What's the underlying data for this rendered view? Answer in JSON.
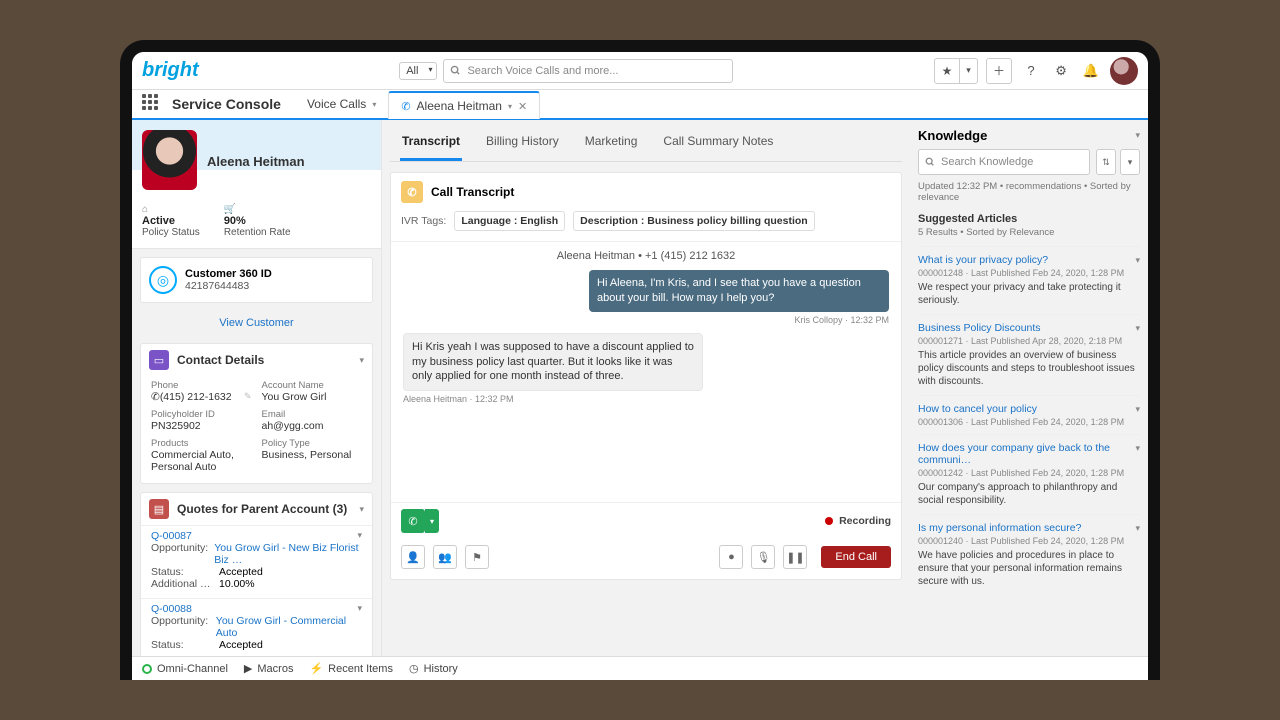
{
  "header": {
    "logo": "bright",
    "scope": "All",
    "search_placeholder": "Search Voice Calls and more..."
  },
  "appnav": {
    "app_name": "Service Console",
    "object": "Voice Calls",
    "tab_label": "Aleena Heitman"
  },
  "customer": {
    "name": "Aleena Heitman",
    "status_value": "Active",
    "status_label": "Policy Status",
    "retention_value": "90%",
    "retention_label": "Retention Rate",
    "c360_title": "Customer 360 ID",
    "c360_id": "42187644483",
    "view": "View Customer"
  },
  "contact": {
    "title": "Contact Details",
    "phone_l": "Phone",
    "phone_v": "(415) 212-1632",
    "account_l": "Account Name",
    "account_v": "You Grow Girl",
    "holder_l": "Policyholder ID",
    "holder_v": "PN325902",
    "email_l": "Email",
    "email_v": "ah@ygg.com",
    "products_l": "Products",
    "products_v": "Commercial Auto, Personal Auto",
    "policytype_l": "Policy Type",
    "policytype_v": "Business, Personal"
  },
  "quotes": {
    "title": "Quotes for Parent Account (3)",
    "items": [
      {
        "num": "Q-00087",
        "opp_l": "Opportunity:",
        "opp_v": "You Grow Girl - New Biz Florist Biz …",
        "status_l": "Status:",
        "status_v": "Accepted",
        "add_l": "Additional …",
        "add_v": "10.00%"
      },
      {
        "num": "Q-00088",
        "opp_l": "Opportunity:",
        "opp_v": "You Grow Girl - Commercial Auto",
        "status_l": "Status:",
        "status_v": "Accepted"
      }
    ]
  },
  "tabs": {
    "items": [
      "Transcript",
      "Billing History",
      "Marketing",
      "Call Summary Notes"
    ],
    "active": 0
  },
  "transcript": {
    "title": "Call Transcript",
    "tags_label": "IVR Tags:",
    "tag1": "Language : English",
    "tag2": "Description : Business policy billing question",
    "party": "Aleena Heitman • +1 (415) 212 1632",
    "msg1": "Hi Aleena, I'm Kris, and I see that you have a question about your bill. How may I help you?",
    "msg1_meta": "Kris Collopy · 12:32 PM",
    "msg2": "Hi Kris yeah I was supposed to have a discount applied to my business policy last quarter. But it looks like it was only applied for one month instead of three.",
    "msg2_meta": "Aleena Heitman · 12:32 PM",
    "recording": "Recording",
    "end": "End Call"
  },
  "knowledge": {
    "title": "Knowledge",
    "search_placeholder": "Search Knowledge",
    "updated": "Updated 12:32 PM • recommendations • Sorted by relevance",
    "suggested_h": "Suggested Articles",
    "suggested_m": "5 Results • Sorted by Relevance",
    "articles": [
      {
        "t": "What is your privacy policy?",
        "m": "000001248 · Last Published  Feb 24, 2020, 1:28 PM",
        "d": "We respect your privacy and take protecting it seriously."
      },
      {
        "t": "Business Policy Discounts",
        "m": "000001271 · Last Published  Apr 28, 2020, 2:18 PM",
        "d": "This article provides an overview of business policy discounts and steps to troubleshoot issues with discounts."
      },
      {
        "t": "How to cancel your policy",
        "m": "000001306 · Last Published  Feb 24, 2020, 1:28 PM",
        "d": ""
      },
      {
        "t": "How does your company give back to the communi…",
        "m": "000001242 · Last Published  Feb 24, 2020, 1:28 PM",
        "d": "Our company's approach to philanthropy and social responsibility."
      },
      {
        "t": "Is my personal information secure?",
        "m": "000001240 · Last Published  Feb 24, 2020, 1:28 PM",
        "d": "We have policies and procedures in place to ensure that your personal information remains secure with us."
      }
    ]
  },
  "footer": {
    "omni": "Omni-Channel",
    "macros": "Macros",
    "recent": "Recent Items",
    "history": "History"
  }
}
